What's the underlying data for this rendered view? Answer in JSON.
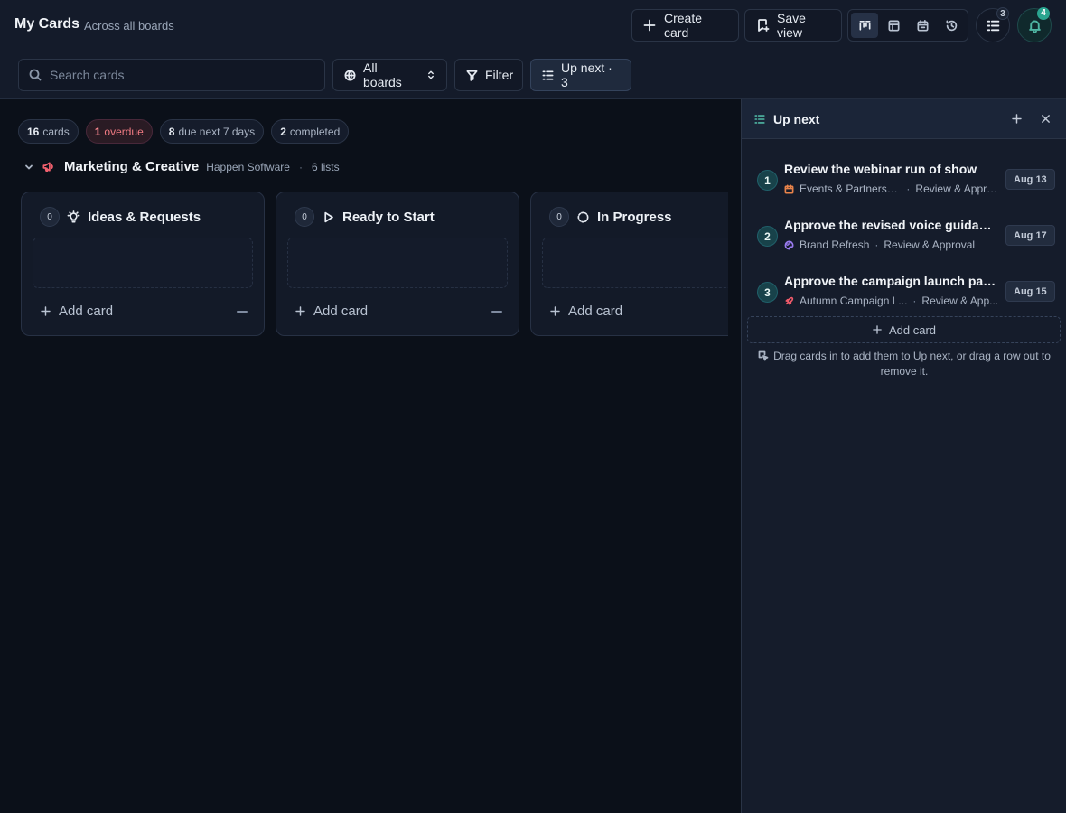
{
  "header": {
    "title": "My Cards",
    "subtitle": "Across all boards",
    "create_card_label": "Create card",
    "save_view_label": "Save view",
    "up_next_count": "3",
    "notifications_count": "4"
  },
  "toolbar": {
    "search_placeholder": "Search cards",
    "boards_label": "All boards",
    "filter_label": "Filter",
    "up_next_label": "Up next · 3"
  },
  "summary": {
    "cards_num": "16",
    "cards_label": "cards",
    "overdue_num": "1",
    "overdue_label": "overdue",
    "due_num": "8",
    "due_label": "due next 7 days",
    "completed_num": "2",
    "completed_label": "completed"
  },
  "group": {
    "name": "Marketing & Creative",
    "org": "Happen Software",
    "separator": "·",
    "lists_count": "6 lists"
  },
  "lists": [
    {
      "title": "Ideas & Requests",
      "count": "0",
      "add_label": "Add card"
    },
    {
      "title": "Ready to Start",
      "count": "0",
      "add_label": "Add card"
    },
    {
      "title": "In Progress",
      "count": "0",
      "add_label": "Add card"
    }
  ],
  "up_next": {
    "title": "Up next",
    "items": [
      {
        "num": "1",
        "title": "Review the webinar run of show",
        "board": "Events & Partnersh...",
        "list": "Review & Appro...",
        "date": "Aug 13",
        "board_color": "#e8834a"
      },
      {
        "num": "2",
        "title": "Approve the revised voice guidance",
        "board": "Brand Refresh",
        "list": "Review & Approval",
        "date": "Aug 17",
        "board_color": "#9a7bf0"
      },
      {
        "num": "3",
        "title": "Approve the campaign launch pack...",
        "board": "Autumn Campaign L...",
        "list": "Review & App...",
        "date": "Aug 15",
        "board_color": "#f05a6a"
      }
    ],
    "dot": "·",
    "add_label": "Add card",
    "hint": "Drag cards in to add them to Up next, or drag a row out to remove it."
  },
  "colors": {
    "accent_teal": "#4fb6a3",
    "overdue_red": "#ff8a92",
    "group_icon": "#f2606e"
  }
}
